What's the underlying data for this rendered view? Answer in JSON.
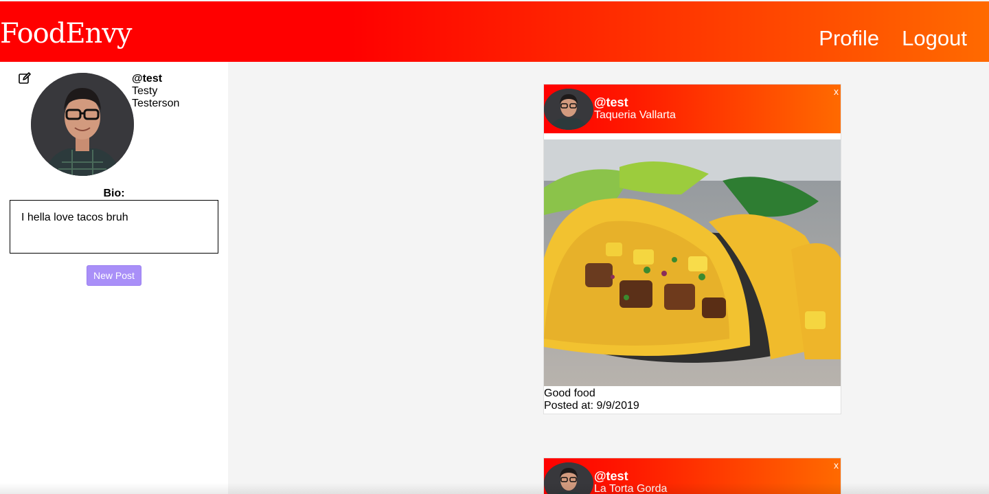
{
  "app": {
    "logo": "FoodEnvy"
  },
  "nav": {
    "profile": "Profile",
    "logout": "Logout"
  },
  "profile": {
    "handle": "@test",
    "first_name": "Testy",
    "last_name": "Testerson",
    "bio_label": "Bio:",
    "bio": "I hella love tacos bruh",
    "new_post_label": "New Post",
    "edit_icon": "edit-icon"
  },
  "posts": [
    {
      "handle": "@test",
      "place": "Taqueria Vallarta",
      "close": "x",
      "caption": "Good food",
      "posted": "Posted at: 9/9/2019"
    },
    {
      "handle": "@test",
      "place": "La Torta Gorda",
      "close": "x"
    }
  ],
  "colors": {
    "header_start": "#ff0000",
    "header_end": "#ff6a00",
    "button": "#a98ff8"
  }
}
